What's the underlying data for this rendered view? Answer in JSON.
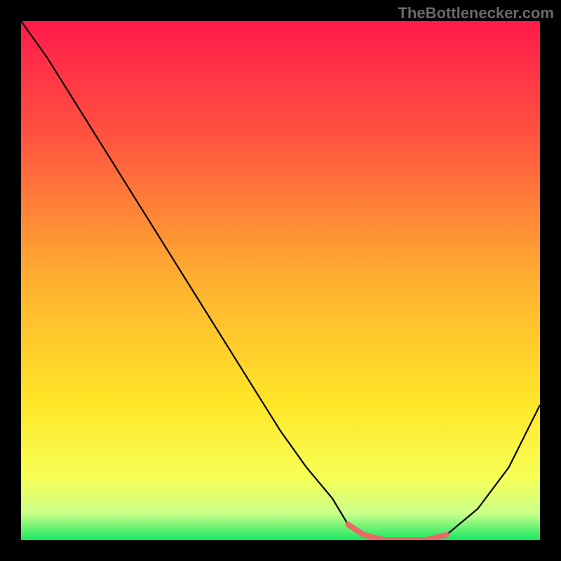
{
  "watermark": "TheBottlenecker.com",
  "chart_data": {
    "type": "line",
    "title": "",
    "xlabel": "",
    "ylabel": "",
    "xlim": [
      0,
      100
    ],
    "ylim": [
      0,
      100
    ],
    "x": [
      0,
      5,
      10,
      15,
      20,
      25,
      30,
      35,
      40,
      45,
      50,
      55,
      60,
      63,
      66,
      70,
      74,
      78,
      82,
      88,
      94,
      100
    ],
    "values": [
      100,
      93,
      85,
      77,
      69,
      61,
      53,
      45,
      37,
      29,
      21,
      14,
      8,
      3,
      1,
      0,
      0,
      0,
      1,
      6,
      14,
      26
    ],
    "series": [
      {
        "name": "bottleneck-curve",
        "color": "#000000",
        "x": [
          0,
          5,
          10,
          15,
          20,
          25,
          30,
          35,
          40,
          45,
          50,
          55,
          60,
          63,
          66,
          70,
          74,
          78,
          82,
          88,
          94,
          100
        ],
        "y": [
          100,
          93,
          85,
          77,
          69,
          61,
          53,
          45,
          37,
          29,
          21,
          14,
          8,
          3,
          1,
          0,
          0,
          0,
          1,
          6,
          14,
          26
        ]
      },
      {
        "name": "optimal-zone",
        "color": "#e86a66",
        "x": [
          63,
          66,
          70,
          74,
          78,
          82
        ],
        "y": [
          3,
          1,
          0,
          0,
          0,
          1
        ]
      }
    ],
    "gradient_stops": [
      {
        "offset": 0,
        "color": "#ff1a4b"
      },
      {
        "offset": 22,
        "color": "#ff5340"
      },
      {
        "offset": 50,
        "color": "#ffb030"
      },
      {
        "offset": 74,
        "color": "#ffe728"
      },
      {
        "offset": 88,
        "color": "#f7ff57"
      },
      {
        "offset": 95,
        "color": "#c8ff8a"
      },
      {
        "offset": 100,
        "color": "#18e860"
      }
    ]
  }
}
